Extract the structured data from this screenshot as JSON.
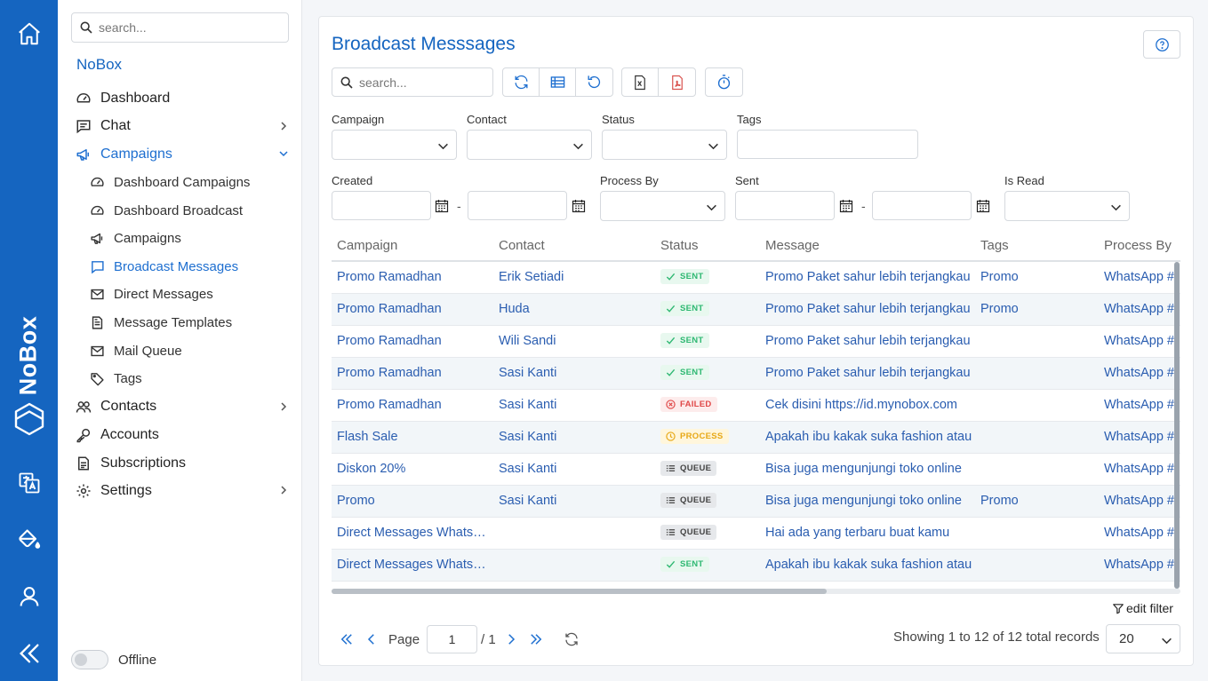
{
  "rail": {
    "brand": "NoBox"
  },
  "sidebar": {
    "search_placeholder": "search...",
    "title": "NoBox",
    "items": [
      {
        "label": "Dashboard"
      },
      {
        "label": "Chat"
      },
      {
        "label": "Campaigns"
      },
      {
        "label": "Dashboard Campaigns"
      },
      {
        "label": "Dashboard Broadcast"
      },
      {
        "label": "Campaigns"
      },
      {
        "label": "Broadcast Messages"
      },
      {
        "label": "Direct Messages"
      },
      {
        "label": "Message Templates"
      },
      {
        "label": "Mail Queue"
      },
      {
        "label": "Tags"
      },
      {
        "label": "Contacts"
      },
      {
        "label": "Accounts"
      },
      {
        "label": "Subscriptions"
      },
      {
        "label": "Settings"
      }
    ],
    "offline_label": "Offline"
  },
  "main": {
    "title": "Broadcast Messsages",
    "search_placeholder": "search...",
    "filters": {
      "campaign": "Campaign",
      "contact": "Contact",
      "status": "Status",
      "tags": "Tags",
      "created": "Created",
      "process_by": "Process By",
      "sent": "Sent",
      "is_read": "Is Read",
      "range_sep": "-"
    },
    "table": {
      "columns": [
        "Campaign",
        "Contact",
        "Status",
        "Message",
        "Tags",
        "Process By"
      ],
      "rows": [
        {
          "campaign": "Promo Ramadhan",
          "contact": "Erik Setiadi",
          "status": "SENT",
          "message": "Promo Paket sahur lebih terjangkau",
          "tags": "Promo",
          "process_by": "WhatsApp #"
        },
        {
          "campaign": "Promo Ramadhan",
          "contact": "Huda",
          "status": "SENT",
          "message": "Promo Paket sahur lebih terjangkau",
          "tags": "Promo",
          "process_by": "WhatsApp #"
        },
        {
          "campaign": "Promo Ramadhan",
          "contact": "Wili Sandi",
          "status": "SENT",
          "message": "Promo Paket sahur lebih terjangkau",
          "tags": "",
          "process_by": "WhatsApp #"
        },
        {
          "campaign": "Promo Ramadhan",
          "contact": "Sasi Kanti",
          "status": "SENT",
          "message": "Promo Paket sahur lebih terjangkau",
          "tags": "",
          "process_by": "WhatsApp #"
        },
        {
          "campaign": "Promo Ramadhan",
          "contact": "Sasi Kanti",
          "status": "FAILED",
          "message": "Cek disini https://id.mynobox.com",
          "tags": "",
          "process_by": "WhatsApp #"
        },
        {
          "campaign": "Flash Sale",
          "contact": "Sasi Kanti",
          "status": "PROCESS",
          "message": "Apakah ibu kakak suka fashion atau",
          "tags": "",
          "process_by": "WhatsApp #"
        },
        {
          "campaign": "Diskon 20%",
          "contact": "Sasi Kanti",
          "status": "QUEUE",
          "message": "Bisa juga mengunjungi toko online",
          "tags": "",
          "process_by": "WhatsApp #"
        },
        {
          "campaign": "Promo",
          "contact": "Sasi Kanti",
          "status": "QUEUE",
          "message": "Bisa juga mengunjungi toko online",
          "tags": "Promo",
          "process_by": "WhatsApp #"
        },
        {
          "campaign": "Direct Messages WhatsApp",
          "contact": "",
          "status": "QUEUE",
          "message": "Hai ada yang terbaru buat kamu",
          "tags": "",
          "process_by": "WhatsApp #"
        },
        {
          "campaign": "Direct Messages WhatsApp",
          "contact": "",
          "status": "SENT",
          "message": "Apakah ibu kakak suka fashion atau",
          "tags": "",
          "process_by": "WhatsApp #"
        }
      ]
    },
    "edit_filter": "edit filter",
    "pager": {
      "page_label": "Page",
      "page_value": "1",
      "total": "/ 1",
      "showing": "Showing 1 to 12 of 12 total records",
      "per_page": "20"
    }
  },
  "colors": {
    "primary": "#1565c0",
    "link": "#2a5db0",
    "sent": "#2eb872",
    "failed": "#e04848",
    "process": "#e7a816",
    "queue": "#444444"
  }
}
